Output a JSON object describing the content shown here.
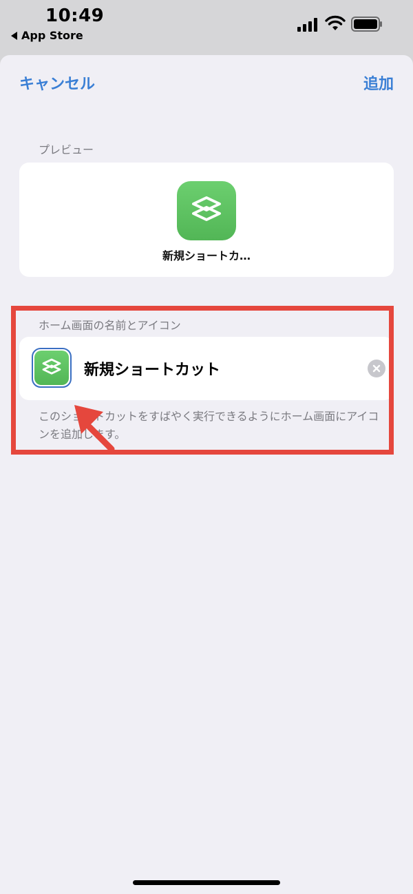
{
  "status_bar": {
    "time": "10:49",
    "back_app": "App Store"
  },
  "nav": {
    "cancel_label": "キャンセル",
    "add_label": "追加"
  },
  "preview": {
    "section_label": "プレビュー",
    "app_name": "新規ショートカ…"
  },
  "home_screen": {
    "section_label": "ホーム画面の名前とアイコン",
    "name_value": "新規ショートカット",
    "footnote": "このショートカットをすばやく実行できるようにホーム画面にアイコンを追加します。"
  },
  "colors": {
    "accent": "#3a7fd5",
    "app_icon_green": "#5cc160",
    "highlight_red": "#e5473d",
    "sheet_background": "#f0eff5"
  },
  "icons": {
    "app_icon": "shortcuts-icon",
    "clear": "clear-icon",
    "back": "back-triangle-icon"
  }
}
